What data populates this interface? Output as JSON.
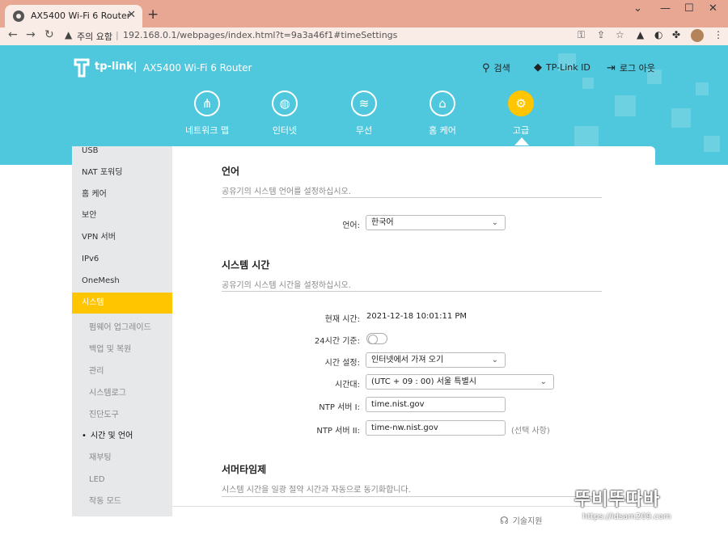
{
  "browser": {
    "tab_title": "AX5400 Wi-Fi 6 Router",
    "new_tab_icon": "+",
    "security_warning": "주의 요함",
    "url": "192.168.0.1/webpages/index.html?t=9a3a46f1#timeSettings"
  },
  "header": {
    "brand": "tp-link",
    "model": "AX5400 Wi-Fi 6 Router",
    "search_label": "검색",
    "tplink_id_label": "TP-Link ID",
    "logout_label": "로그 아웃",
    "accent_color": "#4fc7dc",
    "active_color": "#ffc600"
  },
  "topnav": [
    {
      "label": "네트워크 맵",
      "icon": "network-map-icon"
    },
    {
      "label": "인터넷",
      "icon": "globe-icon"
    },
    {
      "label": "무선",
      "icon": "wifi-icon"
    },
    {
      "label": "홈 케어",
      "icon": "home-care-icon"
    },
    {
      "label": "고급",
      "icon": "gear-icon",
      "active": true
    }
  ],
  "sidebar": {
    "items": [
      {
        "label": "USB"
      },
      {
        "label": "NAT 포워딩"
      },
      {
        "label": "홈 케어"
      },
      {
        "label": "보안"
      },
      {
        "label": "VPN 서버"
      },
      {
        "label": "IPv6"
      },
      {
        "label": "OneMesh"
      },
      {
        "label": "시스템",
        "active": true
      }
    ],
    "sub_items": [
      {
        "label": "펌웨어 업그레이드"
      },
      {
        "label": "백업 및 복원"
      },
      {
        "label": "관리"
      },
      {
        "label": "시스템로그"
      },
      {
        "label": "진단도구"
      },
      {
        "label": "시간 및 언어",
        "current": true
      },
      {
        "label": "재부팅"
      },
      {
        "label": "LED"
      },
      {
        "label": "작동 모드"
      }
    ]
  },
  "language_section": {
    "title": "언어",
    "description": "공유기의 시스템 언어를 설정하십시오.",
    "language_label": "언어:",
    "language_value": "한국어"
  },
  "system_time_section": {
    "title": "시스템 시간",
    "description": "공유기의 시스템 시간을 설정하십시오.",
    "current_time_label": "현재 시간:",
    "current_time_value": "2021-12-18 10:01:11 PM",
    "hour24_label": "24시간 기준:",
    "time_setting_label": "시간 설정:",
    "time_setting_value": "인터넷에서 가져 오기",
    "timezone_label": "시간대:",
    "timezone_value": "(UTC + 09 : 00) 서울 특별시",
    "ntp1_label": "NTP 서버 I:",
    "ntp1_value": "time.nist.gov",
    "ntp2_label": "NTP 서버 II:",
    "ntp2_value": "time-nw.nist.gov",
    "optional_hint": "(선택 사항)"
  },
  "dst_section": {
    "title": "서머타임제",
    "description": "시스템 시간을 일광 절약 시간과 자동으로 동기화합니다."
  },
  "footer": {
    "support_label": "기술지원"
  },
  "watermark": {
    "main": "뚜비뚜따바",
    "sub": "https://idsam209.com"
  }
}
